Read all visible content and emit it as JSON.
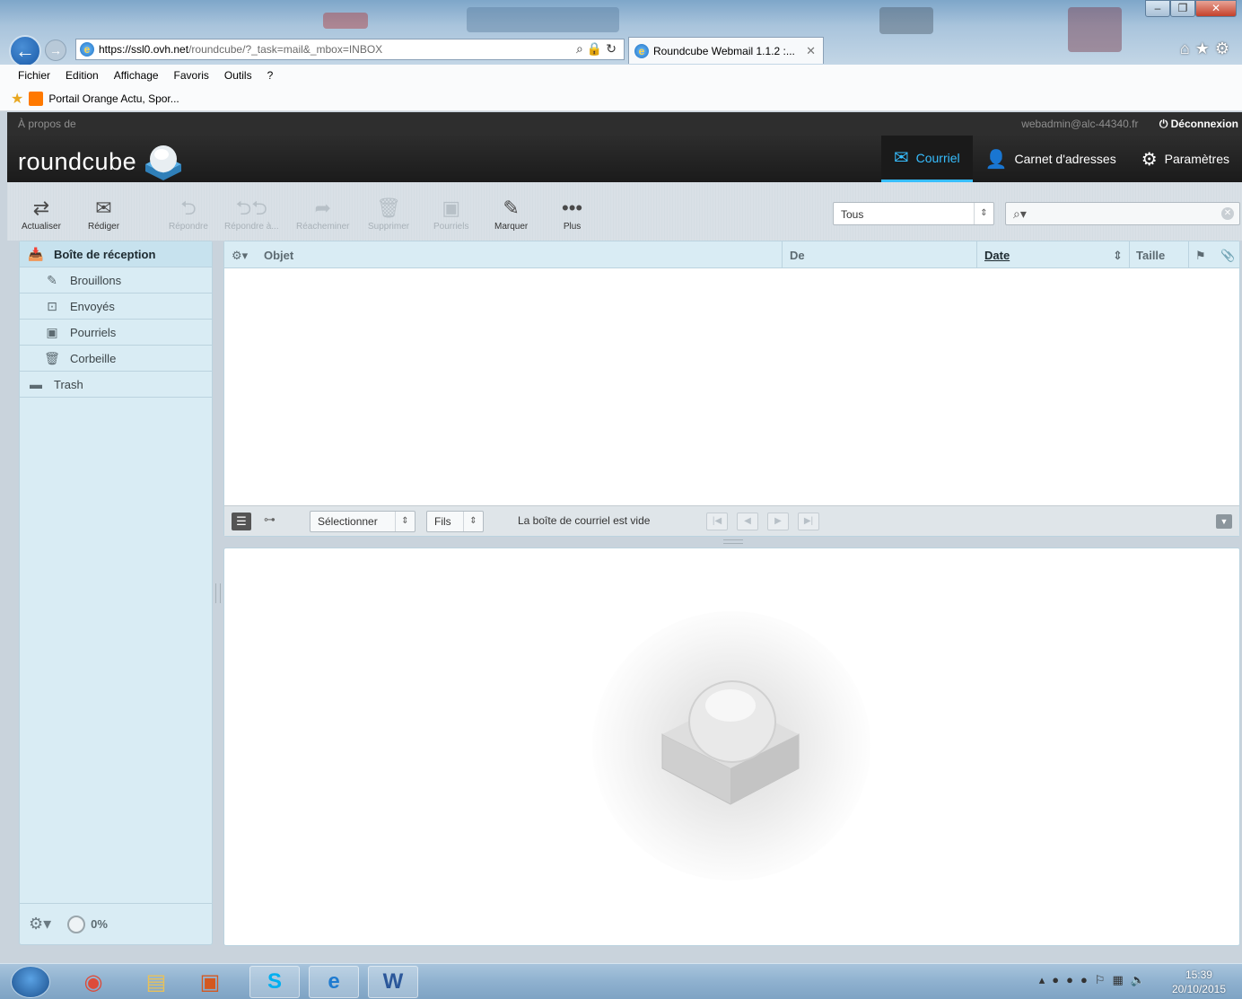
{
  "browser": {
    "url_host": "https://ssl0.ovh.net",
    "url_path": "/roundcube/?_task=mail&_mbox=INBOX",
    "tab_title": "Roundcube Webmail 1.1.2 :...",
    "menu": [
      "Fichier",
      "Edition",
      "Affichage",
      "Favoris",
      "Outils",
      "?"
    ],
    "favorite": "Portail Orange Actu, Spor..."
  },
  "rc": {
    "about": "À propos de",
    "user": "webadmin@alc-44340.fr",
    "logout": "Déconnexion",
    "logo": "roundcube",
    "tabs": {
      "mail": "Courriel",
      "contacts": "Carnet d'adresses",
      "settings": "Paramètres"
    }
  },
  "toolbar": {
    "refresh": "Actualiser",
    "compose": "Rédiger",
    "reply": "Répondre",
    "reply_all": "Répondre à...",
    "forward": "Réacheminer",
    "delete": "Supprimer",
    "junk": "Pourriels",
    "mark": "Marquer",
    "more": "Plus",
    "filter": "Tous",
    "filter_arrows": "⇕"
  },
  "folders": {
    "inbox": "Boîte de réception",
    "drafts": "Brouillons",
    "sent": "Envoyés",
    "junk": "Pourriels",
    "trash_fr": "Corbeille",
    "trash": "Trash",
    "quota": "0%"
  },
  "messagelist": {
    "col_subject": "Objet",
    "col_from": "De",
    "col_date": "Date",
    "col_size": "Taille",
    "select": "Sélectionner",
    "threads": "Fils",
    "status": "La boîte de courriel est vide"
  },
  "taskbar": {
    "time": "15:39",
    "date": "20/10/2015"
  }
}
